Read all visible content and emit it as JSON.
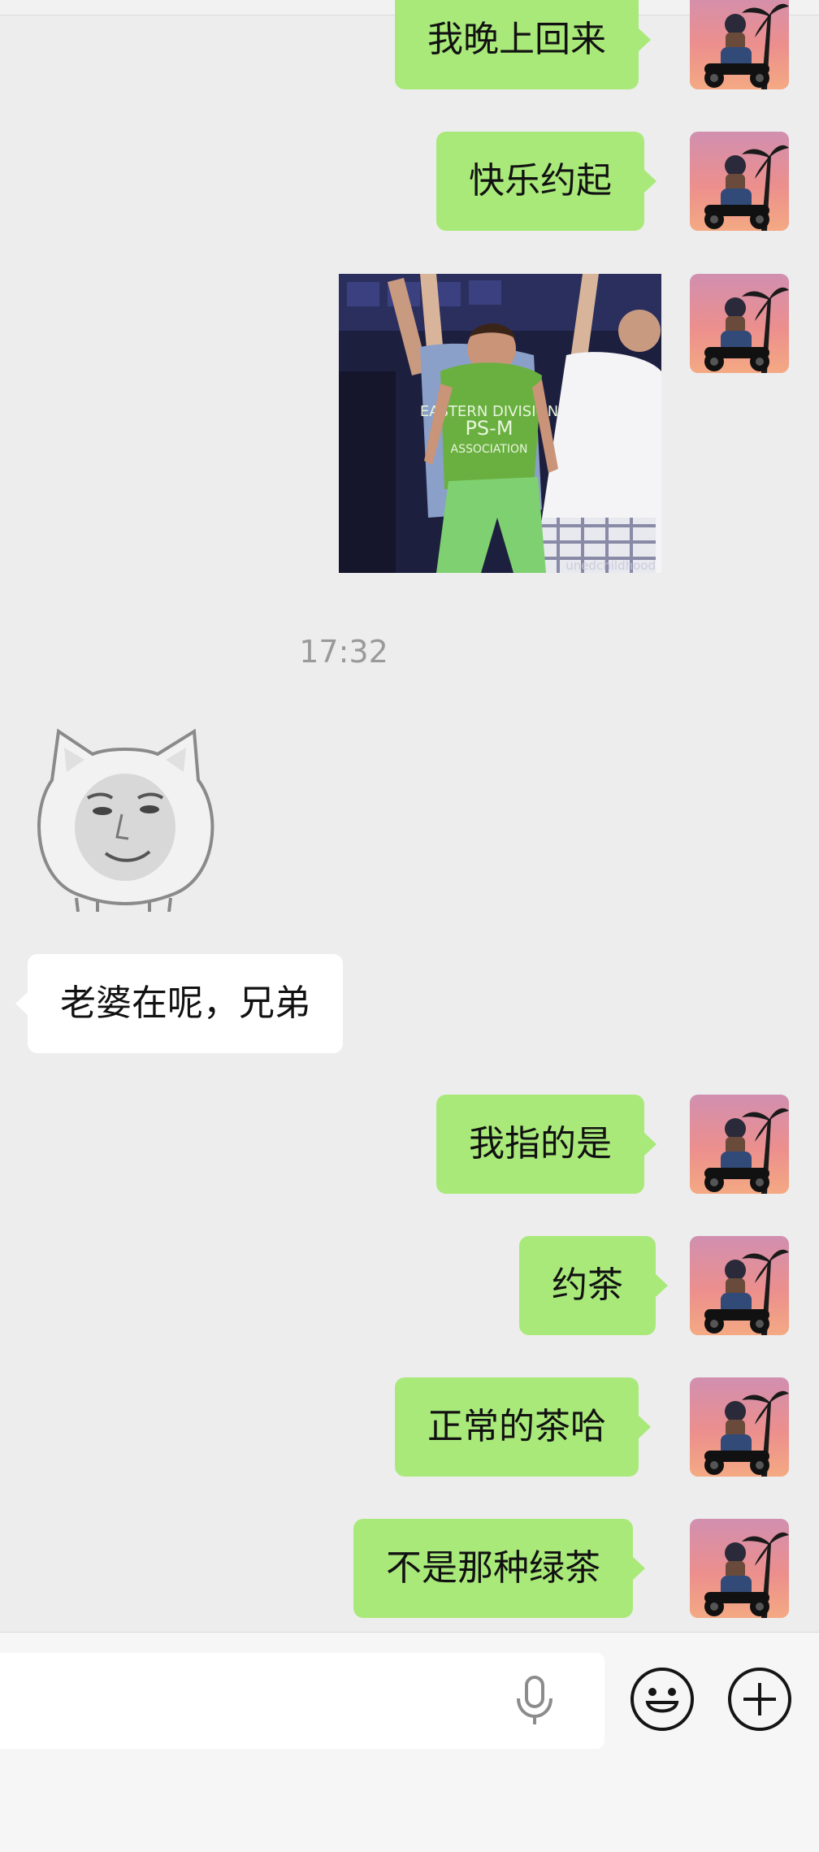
{
  "messages": [
    {
      "side": "out",
      "text": "我晚上回来"
    },
    {
      "side": "out",
      "text": "快乐约起"
    },
    {
      "side": "out",
      "type": "image",
      "watermark": "unedchildhood"
    },
    {
      "side": "out",
      "time": "17:32"
    },
    {
      "side": "in",
      "type": "sticker"
    },
    {
      "side": "in",
      "text": "老婆在呢，兄弟"
    },
    {
      "side": "out",
      "text": "我指的是"
    },
    {
      "side": "out",
      "text": "约茶"
    },
    {
      "side": "out",
      "text": "正常的茶哈"
    },
    {
      "side": "out",
      "text": "不是那种绿茶"
    }
  ],
  "photo": {
    "shirt_text_line1": "EASTERN DIVISION",
    "shirt_text_line2": "PS-M",
    "shirt_text_line3": "ASSOCIATION"
  },
  "input": {
    "mic_icon": "microphone-icon",
    "emoji_icon": "smiley-icon",
    "plus_icon": "plus-circle-icon"
  },
  "colors": {
    "background": "#ededed",
    "outgoing_bubble": "#a9e97a",
    "incoming_bubble": "#ffffff",
    "timestamp": "#9a9a9a"
  }
}
